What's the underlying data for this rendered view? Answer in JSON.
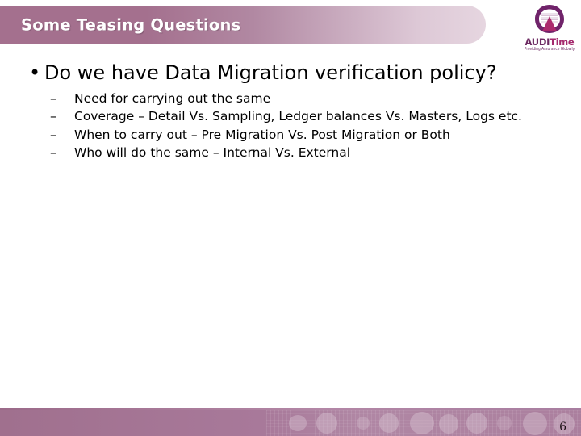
{
  "slide": {
    "title": "Some Teasing Questions",
    "page_number": "6"
  },
  "logo": {
    "wordmark_prefix": "AUDI",
    "wordmark_suffix": "Time",
    "tagline": "Providing Assurance Globally",
    "mark_icon": "auditime-circle-mark-icon"
  },
  "content": {
    "bullet_marker": "•",
    "sub_marker": "–",
    "items": [
      {
        "text": "Do we have Data Migration verification policy?",
        "subitems": [
          "Need for carrying out the same",
          "Coverage – Detail Vs. Sampling, Ledger balances Vs. Masters, Logs etc.",
          "When to carry out – Pre Migration Vs. Post Migration or Both",
          "Who will do the same – Internal Vs. External"
        ]
      }
    ]
  },
  "theme": {
    "banner_start": "#a4708e",
    "banner_end": "#e6d6e0",
    "footer_color": "#a8799a",
    "logo_purple": "#6d2a62",
    "logo_magenta": "#a52a6e",
    "title_text_color": "#ffffff",
    "body_text_color": "#000000"
  }
}
